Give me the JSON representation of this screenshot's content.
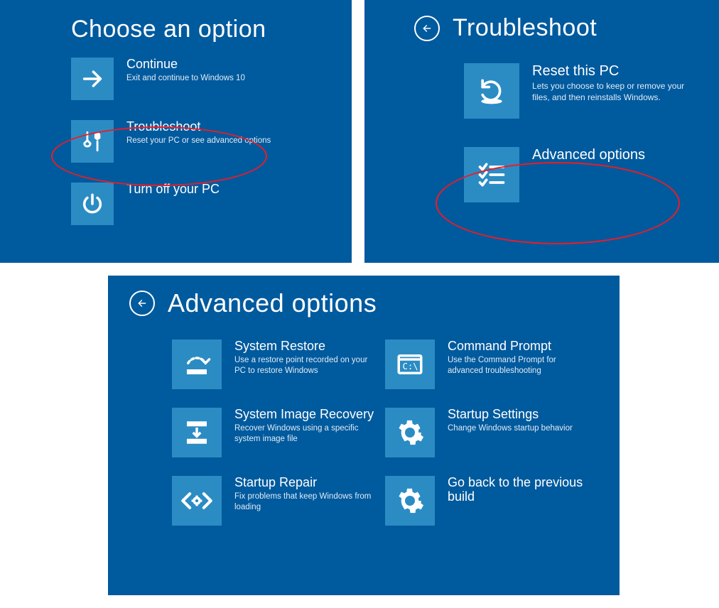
{
  "panel1": {
    "title": "Choose an option",
    "tiles": [
      {
        "title": "Continue",
        "desc": "Exit and continue to Windows 10"
      },
      {
        "title": "Troubleshoot",
        "desc": "Reset your PC or see advanced options"
      },
      {
        "title": "Turn off your PC",
        "desc": ""
      }
    ]
  },
  "panel2": {
    "title": "Troubleshoot",
    "tiles": [
      {
        "title": "Reset this PC",
        "desc": "Lets you choose to keep or remove your files, and then reinstalls Windows."
      },
      {
        "title": "Advanced options",
        "desc": ""
      }
    ]
  },
  "panel3": {
    "title": "Advanced options",
    "tiles": [
      {
        "title": "System Restore",
        "desc": "Use a restore point recorded on your PC to restore Windows"
      },
      {
        "title": "Command Prompt",
        "desc": "Use the Command Prompt for advanced troubleshooting"
      },
      {
        "title": "System Image Recovery",
        "desc": "Recover Windows using a specific system image file"
      },
      {
        "title": "Startup Settings",
        "desc": "Change Windows startup behavior"
      },
      {
        "title": "Startup Repair",
        "desc": "Fix problems that keep Windows from loading"
      },
      {
        "title": "Go back to the previous build",
        "desc": ""
      }
    ]
  }
}
